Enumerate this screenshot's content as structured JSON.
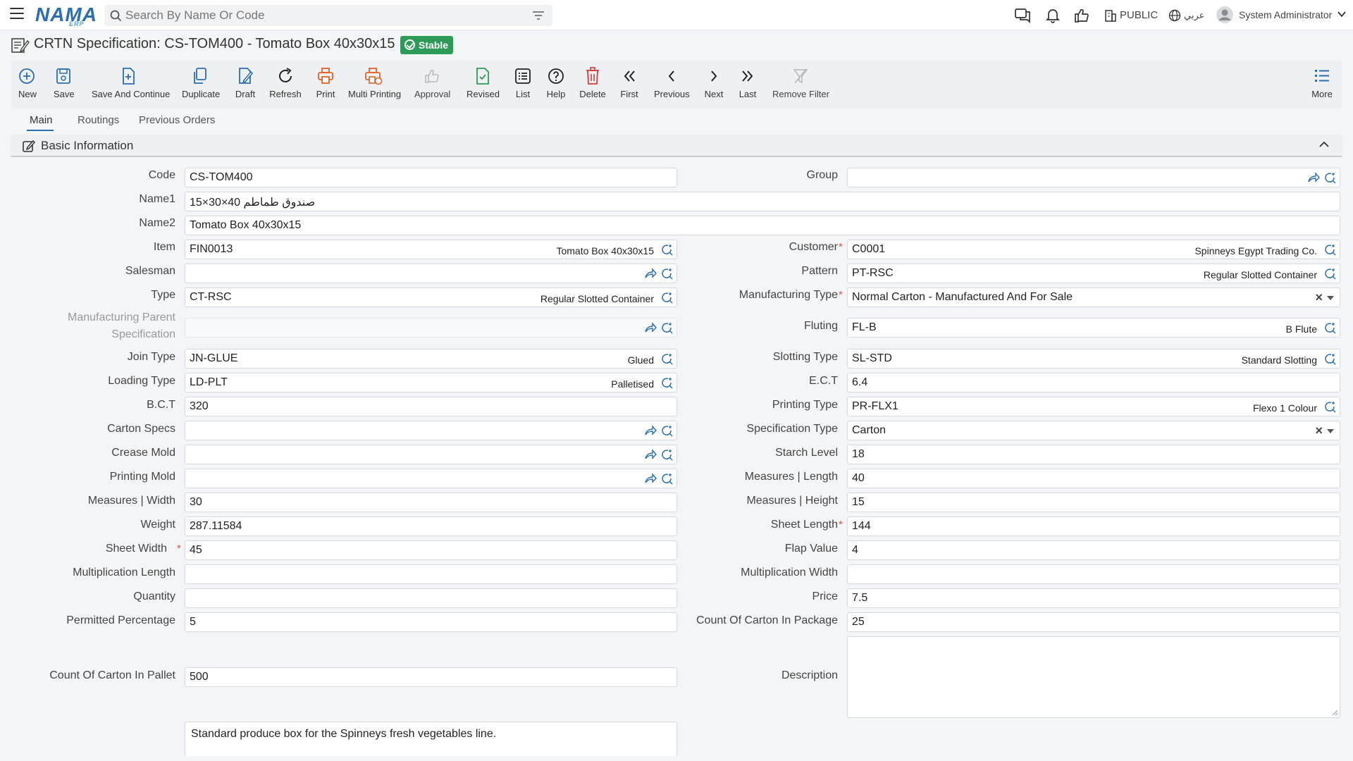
{
  "header": {
    "logo_text": "NAMA",
    "logo_sub": "ERP",
    "search_placeholder": "Search By Name Or Code",
    "public_label": "PUBLIC",
    "language_label": "عربي",
    "user_name": "System Administrator"
  },
  "page": {
    "title": "CRTN Specification: CS-TOM400 - Tomato Box 40x30x15",
    "status": "Stable"
  },
  "toolbar": [
    {
      "label": "New",
      "icon": "plus-circle-icon"
    },
    {
      "label": "Save",
      "icon": "save-icon"
    },
    {
      "label": "Save And Continue",
      "icon": "save-continue-icon"
    },
    {
      "label": "Duplicate",
      "icon": "duplicate-icon"
    },
    {
      "label": "Draft",
      "icon": "draft-icon"
    },
    {
      "label": "Refresh",
      "icon": "refresh-icon"
    },
    {
      "label": "Print",
      "icon": "print-icon"
    },
    {
      "label": "Multi Printing",
      "icon": "multi-print-icon"
    },
    {
      "label": "Approval",
      "icon": "thumbs-up-icon"
    },
    {
      "label": "Revised",
      "icon": "revised-icon"
    },
    {
      "label": "List",
      "icon": "list-icon"
    },
    {
      "label": "Help",
      "icon": "help-icon"
    },
    {
      "label": "Delete",
      "icon": "trash-icon"
    },
    {
      "label": "First",
      "icon": "first-icon"
    },
    {
      "label": "Previous",
      "icon": "previous-icon"
    },
    {
      "label": "Next",
      "icon": "next-icon"
    },
    {
      "label": "Last",
      "icon": "last-icon"
    },
    {
      "label": "Remove Filter",
      "icon": "remove-filter-icon"
    },
    {
      "label": "More",
      "icon": "more-icon"
    }
  ],
  "tabs": [
    "Main",
    "Routings",
    "Previous Orders"
  ],
  "section": {
    "title": "Basic Information"
  },
  "fields": {
    "code": {
      "label": "Code",
      "value": "CS-TOM400"
    },
    "group": {
      "label": "Group",
      "value": ""
    },
    "name1": {
      "label": "Name1",
      "value": "صندوق طماطم 40×30×15"
    },
    "name2": {
      "label": "Name2",
      "value": "Tomato Box 40x30x15"
    },
    "item": {
      "label": "Item",
      "value": "FIN0013",
      "desc": "Tomato Box 40x30x15"
    },
    "customer": {
      "label": "Customer",
      "value": "C0001",
      "desc": "Spinneys Egypt Trading Co."
    },
    "salesman": {
      "label": "Salesman",
      "value": ""
    },
    "pattern": {
      "label": "Pattern",
      "value": "PT-RSC",
      "desc": "Regular Slotted Container"
    },
    "type": {
      "label": "Type",
      "value": "CT-RSC",
      "desc": "Regular Slotted Container"
    },
    "manufacturing_type": {
      "label": "Manufacturing Type",
      "value": "Normal Carton - Manufactured And For Sale"
    },
    "parent_spec": {
      "label": "Manufacturing Parent Specification",
      "value": ""
    },
    "fluting": {
      "label": "Fluting",
      "value": "FL-B",
      "desc": "B Flute"
    },
    "join_type": {
      "label": "Join Type",
      "value": "JN-GLUE",
      "desc": "Glued"
    },
    "slotting_type": {
      "label": "Slotting Type",
      "value": "SL-STD",
      "desc": "Standard Slotting"
    },
    "loading_type": {
      "label": "Loading Type",
      "value": "LD-PLT",
      "desc": "Palletised"
    },
    "ect": {
      "label": "E.C.T",
      "value": "6.4"
    },
    "bct": {
      "label": "B.C.T",
      "value": "320"
    },
    "printing_type": {
      "label": "Printing Type",
      "value": "PR-FLX1",
      "desc": "Flexo 1 Colour"
    },
    "carton_specs": {
      "label": "Carton Specs",
      "value": ""
    },
    "specification_type": {
      "label": "Specification Type",
      "value": "Carton"
    },
    "crease_mold": {
      "label": "Crease Mold",
      "value": ""
    },
    "starch_level": {
      "label": "Starch Level",
      "value": "18"
    },
    "printing_mold": {
      "label": "Printing Mold",
      "value": ""
    },
    "measures_length": {
      "label": "Measures | Length",
      "value": "40"
    },
    "measures_width": {
      "label": "Measures | Width",
      "value": "30"
    },
    "measures_height": {
      "label": "Measures | Height",
      "value": "15"
    },
    "weight": {
      "label": "Weight",
      "value": "287.11584"
    },
    "sheet_length": {
      "label": "Sheet Length",
      "value": "144"
    },
    "sheet_width": {
      "label": "Sheet Width",
      "value": "45"
    },
    "flap_value": {
      "label": "Flap Value",
      "value": "4"
    },
    "multiplication_length": {
      "label": "Multiplication Length",
      "value": ""
    },
    "multiplication_width": {
      "label": "Multiplication Width",
      "value": ""
    },
    "quantity": {
      "label": "Quantity",
      "value": ""
    },
    "price": {
      "label": "Price",
      "value": "7.5"
    },
    "permitted_percentage": {
      "label": "Permitted Percentage",
      "value": "5"
    },
    "count_in_package": {
      "label": "Count Of Carton In Package",
      "value": "25"
    },
    "count_in_pallet": {
      "label": "Count Of Carton In Pallet",
      "value": "500"
    },
    "description": {
      "label": "Description",
      "value": ""
    },
    "notes": {
      "value": "Standard produce box for the Spinneys fresh vegetables line."
    }
  }
}
